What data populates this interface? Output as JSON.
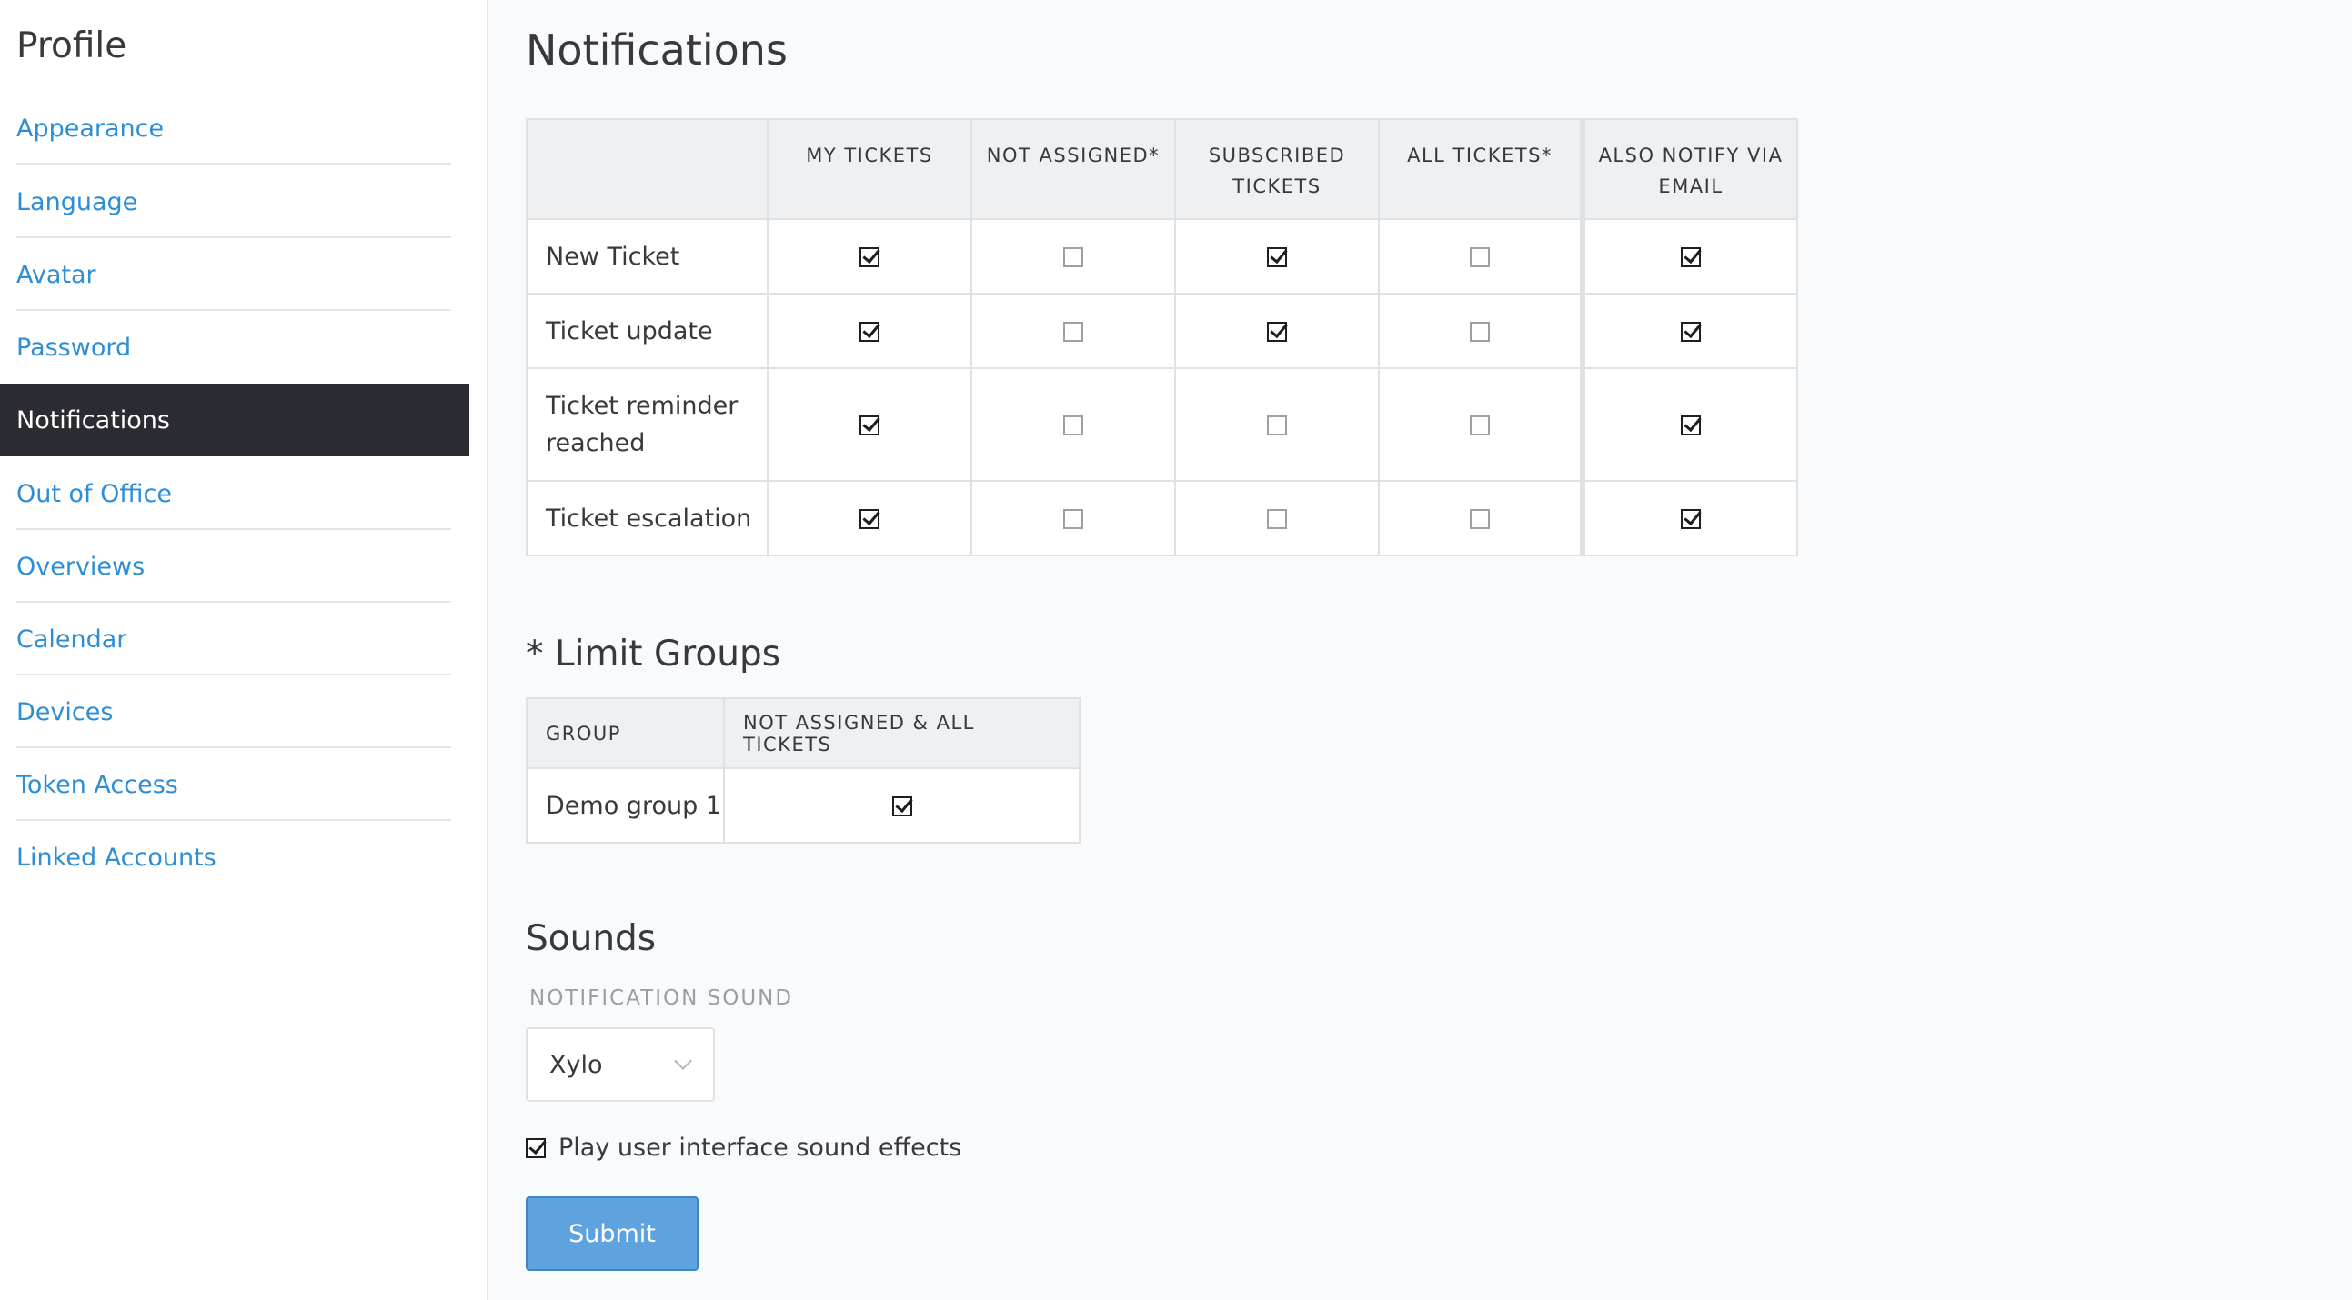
{
  "sidebar": {
    "title": "Profile",
    "items": [
      {
        "label": "Appearance"
      },
      {
        "label": "Language"
      },
      {
        "label": "Avatar"
      },
      {
        "label": "Password"
      },
      {
        "label": "Notifications",
        "active": true
      },
      {
        "label": "Out of Office"
      },
      {
        "label": "Overviews"
      },
      {
        "label": "Calendar"
      },
      {
        "label": "Devices"
      },
      {
        "label": "Token Access"
      },
      {
        "label": "Linked Accounts"
      }
    ]
  },
  "main": {
    "title": "Notifications",
    "matrix": {
      "headers": [
        "MY TICKETS",
        "NOT ASSIGNED*",
        "SUBSCRIBED TICKETS",
        "ALL TICKETS*",
        "ALSO NOTIFY VIA EMAIL"
      ],
      "rows": [
        {
          "label": "New Ticket",
          "checked": [
            true,
            false,
            true,
            false,
            true
          ]
        },
        {
          "label": "Ticket update",
          "checked": [
            true,
            false,
            true,
            false,
            true
          ]
        },
        {
          "label": "Ticket reminder reached",
          "checked": [
            true,
            false,
            false,
            false,
            true
          ]
        },
        {
          "label": "Ticket escalation",
          "checked": [
            true,
            false,
            false,
            false,
            true
          ]
        }
      ]
    },
    "limit_groups": {
      "title": "* Limit Groups",
      "headers": [
        "GROUP",
        "NOT ASSIGNED & ALL TICKETS"
      ],
      "rows": [
        {
          "group": "Demo group 1",
          "checked": true
        }
      ]
    },
    "sounds": {
      "title": "Sounds",
      "field_label": "NOTIFICATION SOUND",
      "selected": "Xylo",
      "effects_label": "Play user interface sound effects",
      "effects_checked": true
    },
    "submit_label": "Submit"
  },
  "colors": {
    "link": "#2d8ed5",
    "active_bg": "#2b2c33",
    "submit_bg": "#5fa3de"
  }
}
